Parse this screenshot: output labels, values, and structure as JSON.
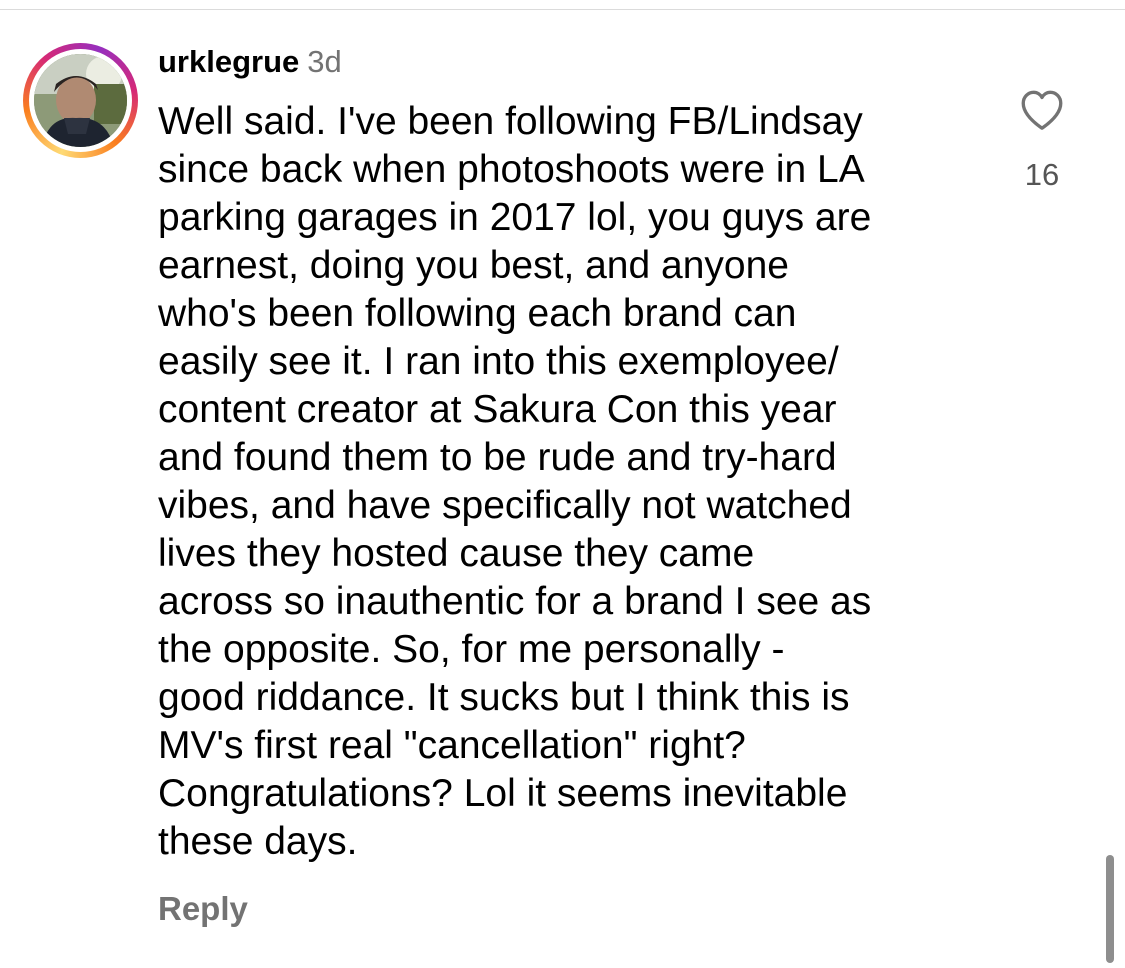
{
  "comment": {
    "username": "urklegrue",
    "timestamp": "3d",
    "text": "Well said. I've been following FB/Lindsay\nsince back when photoshoots were in LA\nparking garages in 2017 lol, you guys are\nearnest, doing you best, and anyone\nwho's been following each brand can\neasily see it. I ran into this exemployee/\ncontent creator at Sakura Con this year\nand found them to be rude and try-hard\nvibes, and have specifically not watched\nlives they hosted cause they came\nacross so inauthentic for a brand I see as\nthe opposite. So, for me personally -\ngood riddance. It sucks but I think this is\nMV's first real \"cancellation\" right?\nCongratulations? Lol it seems inevitable\nthese days.",
    "reply_label": "Reply",
    "like_count": "16",
    "like_icon": "heart-outline-icon",
    "avatar_icon": "profile-photo"
  },
  "colors": {
    "text": "#000000",
    "secondary_text": "#737373",
    "story_ring": [
      "#feda75",
      "#fa7e1e",
      "#d62976",
      "#962fbf"
    ]
  }
}
